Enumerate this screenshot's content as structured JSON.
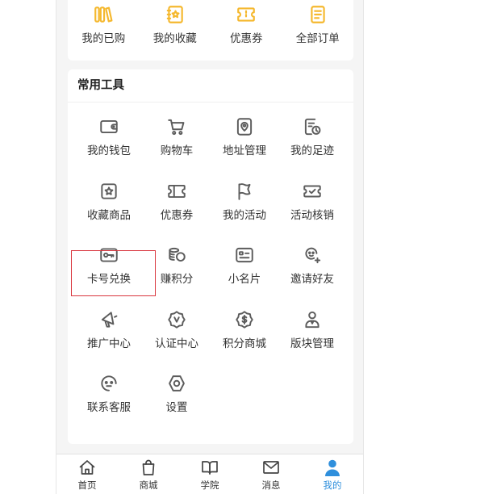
{
  "top_card": {
    "items": [
      {
        "label": "我的已购",
        "icon": "purchased-icon"
      },
      {
        "label": "我的收藏",
        "icon": "favorites-icon"
      },
      {
        "label": "优惠券",
        "icon": "coupon-icon"
      },
      {
        "label": "全部订单",
        "icon": "orders-icon"
      }
    ]
  },
  "tools": {
    "title": "常用工具",
    "items": [
      {
        "label": "我的钱包",
        "icon": "wallet-icon"
      },
      {
        "label": "购物车",
        "icon": "cart-icon"
      },
      {
        "label": "地址管理",
        "icon": "address-icon"
      },
      {
        "label": "我的足迹",
        "icon": "footprint-icon"
      },
      {
        "label": "收藏商品",
        "icon": "favorite-goods-icon"
      },
      {
        "label": "优惠券",
        "icon": "coupon-ticket-icon"
      },
      {
        "label": "我的活动",
        "icon": "flag-icon"
      },
      {
        "label": "活动核销",
        "icon": "verify-ticket-icon"
      },
      {
        "label": "卡号兑换",
        "icon": "key-card-icon"
      },
      {
        "label": "赚积分",
        "icon": "coins-icon"
      },
      {
        "label": "小名片",
        "icon": "id-card-icon"
      },
      {
        "label": "邀请好友",
        "icon": "invite-friend-icon"
      },
      {
        "label": "推广中心",
        "icon": "megaphone-icon"
      },
      {
        "label": "认证中心",
        "icon": "verified-badge-icon"
      },
      {
        "label": "积分商城",
        "icon": "points-badge-icon"
      },
      {
        "label": "版块管理",
        "icon": "manager-icon"
      },
      {
        "label": "联系客服",
        "icon": "customer-service-icon"
      },
      {
        "label": "设置",
        "icon": "settings-icon"
      }
    ]
  },
  "tabbar": {
    "items": [
      {
        "label": "首页",
        "icon": "home-icon",
        "active": false
      },
      {
        "label": "商城",
        "icon": "shopping-bag-icon",
        "active": false
      },
      {
        "label": "学院",
        "icon": "book-icon",
        "active": false
      },
      {
        "label": "消息",
        "icon": "mail-icon",
        "active": false
      },
      {
        "label": "我的",
        "icon": "user-icon",
        "active": true
      }
    ]
  },
  "colors": {
    "accent": "#f5b82e",
    "icon_gray": "#5c5c5c",
    "active": "#2f8fdc",
    "highlight": "#d9363e",
    "page_bg": "#f5f5f5"
  }
}
